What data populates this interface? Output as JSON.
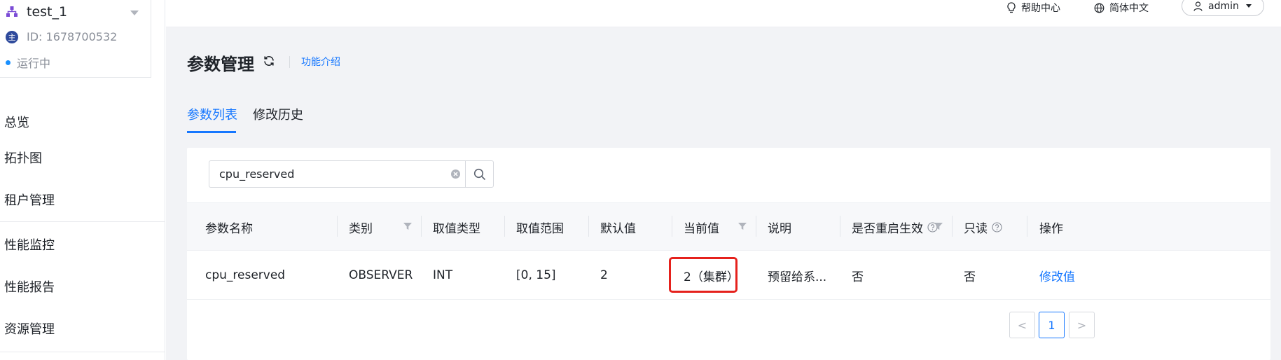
{
  "sidebar": {
    "cluster_name": "test_1",
    "cluster_id": "ID: 1678700532",
    "id_badge": "主",
    "status": "运行中",
    "nav": [
      "总览",
      "拓扑图",
      "租户管理",
      "性能监控",
      "性能报告",
      "资源管理"
    ]
  },
  "topbar": {
    "help": "帮助中心",
    "language": "简体中文",
    "user": "admin"
  },
  "page": {
    "title": "参数管理",
    "intro_link": "功能介绍",
    "tabs": [
      "参数列表",
      "修改历史"
    ]
  },
  "search": {
    "value": "cpu_reserved"
  },
  "table": {
    "headers": [
      "参数名称",
      "类别",
      "取值类型",
      "取值范围",
      "默认值",
      "当前值",
      "说明",
      "是否重启生效",
      "只读",
      "操作"
    ],
    "row": {
      "name": "cpu_reserved",
      "category": "OBSERVER",
      "value_type": "INT",
      "range": "[0, 15]",
      "default": "2",
      "current": "2（集群）",
      "description": "预留给系...",
      "restart": "否",
      "readonly": "否",
      "action": "修改值"
    }
  },
  "pagination": {
    "prev": "<",
    "current": "1",
    "next": ">"
  },
  "colors": {
    "accent": "#1677ff",
    "highlight": "#e5211c",
    "badge": "#2e4a9c"
  }
}
